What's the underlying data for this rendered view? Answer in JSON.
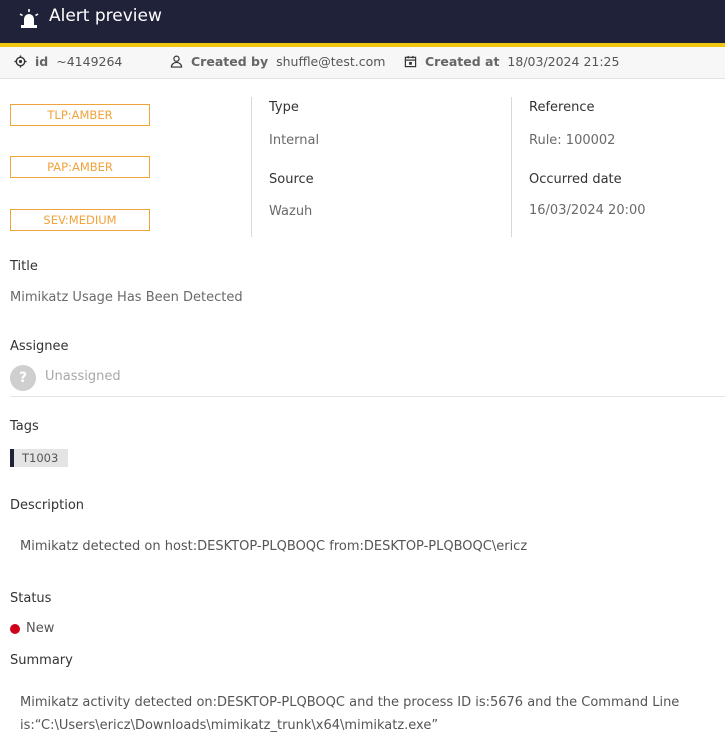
{
  "header": {
    "title": "Alert preview",
    "icon": "alarm-light-icon"
  },
  "meta": {
    "id_label": "id",
    "id_value": "~4149264",
    "created_by_label": "Created by",
    "created_by_value": "shuffle@test.com",
    "created_at_label": "Created at",
    "created_at_value": "18/03/2024 21:25"
  },
  "badges": {
    "tlp": "TLP:AMBER",
    "pap": "PAP:AMBER",
    "sev": "SEV:MEDIUM",
    "color": "#f0a33a"
  },
  "details": {
    "type_label": "Type",
    "type_value": "Internal",
    "source_label": "Source",
    "source_value": "Wazuh",
    "reference_label": "Reference",
    "reference_value": "Rule: 100002",
    "occurred_label": "Occurred date",
    "occurred_value": "16/03/2024 20:00"
  },
  "title_section": {
    "label": "Title",
    "value": "Mimikatz Usage Has Been Detected"
  },
  "assignee": {
    "label": "Assignee",
    "avatar": "?",
    "value": "Unassigned"
  },
  "tags": {
    "label": "Tags",
    "items": [
      "T1003"
    ]
  },
  "description": {
    "label": "Description",
    "value": "Mimikatz detected on host:DESKTOP-PLQBOQC from:DESKTOP-PLQBOQC\\ericz"
  },
  "status": {
    "label": "Status",
    "value": "New",
    "color": "#d0021b"
  },
  "summary": {
    "label": "Summary",
    "value": "Mimikatz activity detected on:DESKTOP-PLQBOQC and the process ID is:5676 and the Command Line is:“C:\\Users\\ericz\\Downloads\\mimikatz_trunk\\x64\\mimikatz.exe”"
  }
}
